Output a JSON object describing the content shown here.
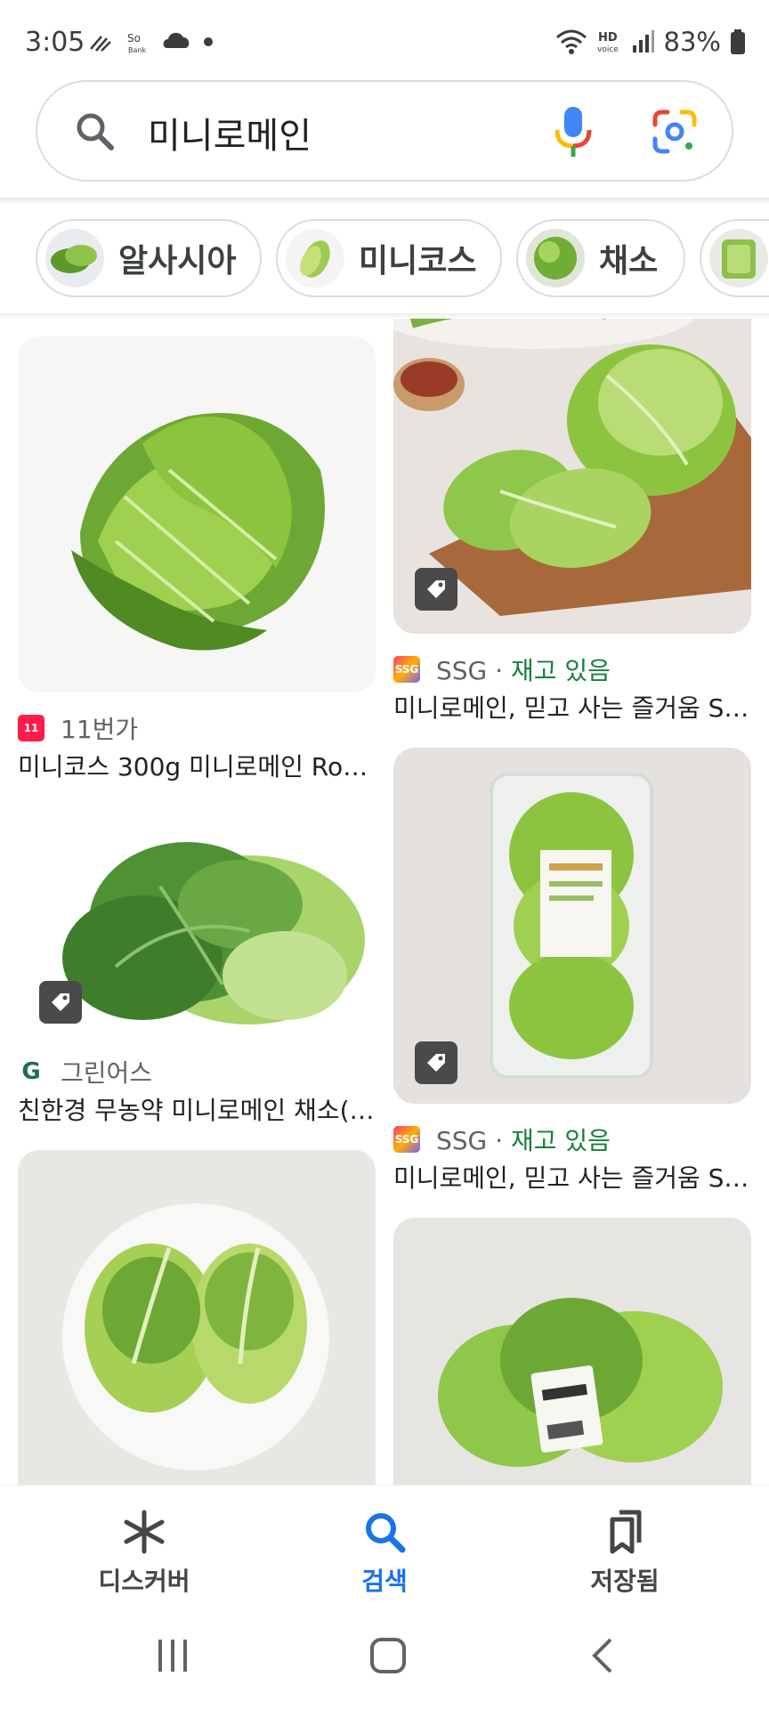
{
  "status_bar": {
    "time": "3:05",
    "battery": "83%",
    "hd_voice": "HD",
    "hd_voice_sub": "voice",
    "icons_left": [
      "signal-wave-icon",
      "soft-bank-icon",
      "cloud-icon",
      "dot-icon"
    ],
    "icons_right": [
      "wifi-icon",
      "hd-voice-icon",
      "cell-signal-icon",
      "battery-icon"
    ]
  },
  "search": {
    "query": "미니로메인"
  },
  "chips": [
    {
      "label": "알사시아"
    },
    {
      "label": "미니코스"
    },
    {
      "label": "채소"
    },
    {
      "label": ""
    }
  ],
  "results": {
    "left": [
      {
        "source": "11번가",
        "title": "미니코스 300g 미니로메인 Ro…",
        "logo_text": "11",
        "logo_color": "#ff1b4a"
      },
      {
        "source": "그린어스",
        "title": "친한경 무농약 미니로메인 채소(…",
        "logo_text": "G",
        "logo_color": "#1e6e4e"
      }
    ],
    "right": [
      {
        "source": "SSG",
        "stock": "재고 있음",
        "title": "미니로메인, 믿고 사는 즐거움 S…",
        "logo_text": "SSG"
      },
      {
        "source": "SSG",
        "stock": "재고 있음",
        "title": "미니로메인, 믿고 사는 즐거움 S…",
        "logo_text": "SSG"
      }
    ],
    "separator": "·"
  },
  "bottom_nav": {
    "items": [
      {
        "label": "디스커버",
        "icon": "discover-asterisk-icon"
      },
      {
        "label": "검색",
        "icon": "search-icon",
        "active": true
      },
      {
        "label": "저장됨",
        "icon": "saved-bookmarks-icon"
      }
    ]
  },
  "colors": {
    "accent": "#1a73e8",
    "stock_green": "#188038",
    "lettuce_light": "#b6d96a",
    "lettuce_dark": "#5b9a2a"
  }
}
